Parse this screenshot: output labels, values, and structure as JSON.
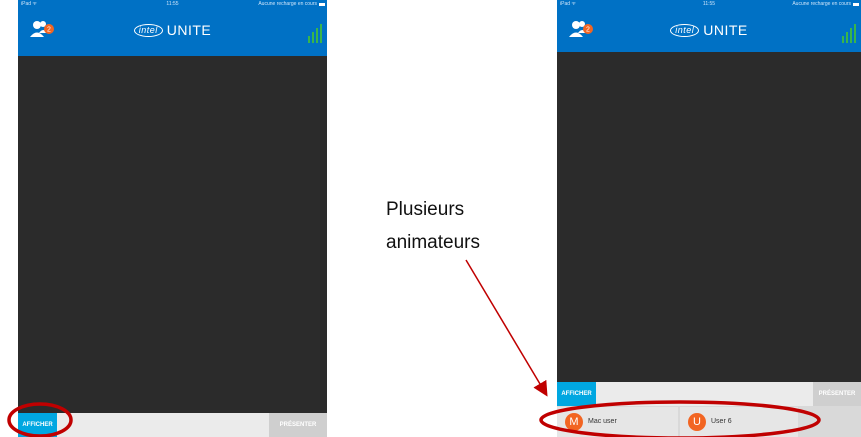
{
  "status_bar": {
    "carrier": "iPad ᯤ",
    "time": "11:55",
    "charging": "Aucune recharge en cours"
  },
  "app": {
    "logo_text": "intel",
    "name": "UNITE",
    "notification_badge": "2"
  },
  "bottom_bar": {
    "show_button": "AFFICHER",
    "present_button": "PRÉSENTER"
  },
  "presenters": [
    {
      "initial": "M",
      "name": "Mac user"
    },
    {
      "initial": "U",
      "name": "User 6"
    }
  ],
  "annotation": {
    "line1": "Plusieurs",
    "line2": "animateurs"
  },
  "colors": {
    "header_blue": "#0071c5",
    "afficher_blue": "#00a7e1",
    "signal_green": "#39b54a",
    "badge_orange": "#f26522",
    "highlight_red": "#c00000",
    "screen_dark": "#2b2b2b"
  },
  "icons": [
    "users-icon",
    "notification-badge",
    "signal-bars-icon",
    "battery-icon"
  ]
}
